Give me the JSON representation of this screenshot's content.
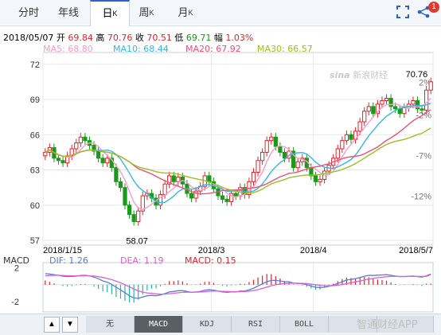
{
  "tabs": [
    {
      "label": "分时",
      "sup": ""
    },
    {
      "label": "年线",
      "sup": ""
    },
    {
      "label": "日",
      "sup": "K"
    },
    {
      "label": "周",
      "sup": "K"
    },
    {
      "label": "月",
      "sup": "K"
    }
  ],
  "badge": "1",
  "quote": {
    "date": "2018/05/07",
    "open_label": "开",
    "open": "69.84",
    "high_label": "高",
    "high": "70.76",
    "close_label": "收",
    "close": "70.51",
    "low_label": "低",
    "low": "69.71",
    "change_label": "幅",
    "change": "1.03%"
  },
  "ma": [
    {
      "label": "MA5: 68.80",
      "color": "#ff9bc8"
    },
    {
      "label": "MA10: 68.44",
      "color": "#35b6e6"
    },
    {
      "label": "MA20: 67.92",
      "color": "#f0507a"
    },
    {
      "label": "MA30: 66.57",
      "color": "#9fbf1f"
    }
  ],
  "macd_labels": {
    "title": "MACD",
    "dif": "DIF: 1.26",
    "dea": "DEA: 1.19",
    "macd": "MACD: 0.15"
  },
  "watermark": {
    "top": "新浪财经",
    "bottom": "智通财经APP"
  },
  "bottom_bar": {
    "prev": "▲",
    "next": "▼",
    "indicators": [
      "无",
      "MACD",
      "KDJ",
      "RSI",
      "BOLL",
      "",
      ""
    ]
  },
  "chart_data": {
    "type": "candlestick",
    "ylim": [
      56.6,
      73.0
    ],
    "y_ticks": [
      "72",
      "69",
      "66",
      "63",
      "60",
      "57"
    ],
    "y_pct_ticks": [
      "2%",
      "-2%",
      "-7%",
      "-12%"
    ],
    "x_tick_labels": [
      "2018/1/15",
      "2018/3",
      "2018/4",
      "2018/5/7"
    ],
    "x_tick_index": [
      0,
      38,
      61,
      87
    ],
    "annotations": {
      "max": "70.76",
      "min": "58.07"
    },
    "macd_ticks": [
      "2",
      "-2"
    ],
    "macd_ylim": [
      -3.2,
      2.6
    ],
    "close": [
      64.5,
      64.9,
      64.0,
      63.8,
      63.6,
      64.2,
      64.8,
      65.3,
      65.8,
      65.5,
      65.1,
      64.6,
      64.0,
      63.6,
      64.0,
      63.2,
      62.0,
      61.5,
      60.0,
      59.2,
      58.6,
      59.5,
      60.8,
      61.0,
      60.6,
      60.0,
      60.9,
      61.8,
      62.5,
      62.0,
      62.4,
      61.8,
      61.0,
      60.6,
      61.2,
      61.6,
      62.5,
      62.0,
      61.4,
      60.8,
      60.5,
      60.3,
      61.0,
      60.8,
      61.5,
      60.9,
      62.0,
      62.8,
      63.8,
      64.5,
      65.5,
      65.8,
      65.0,
      64.5,
      64.0,
      64.6,
      63.2,
      63.7,
      64.0,
      63.2,
      62.5,
      62.0,
      62.2,
      62.9,
      63.4,
      64.0,
      64.8,
      65.5,
      66.0,
      65.6,
      66.3,
      67.1,
      68.0,
      68.4,
      67.8,
      68.6,
      68.9,
      69.1,
      68.4,
      68.2,
      67.8,
      68.3,
      68.6,
      68.9,
      68.2,
      68.1,
      69.8,
      70.51
    ],
    "macd": {
      "dif": [
        1.3,
        1.25,
        1.18,
        1.1,
        1.0,
        0.95,
        0.96,
        1.0,
        1.08,
        1.1,
        1.05,
        0.9,
        0.7,
        0.45,
        0.3,
        0.05,
        -0.3,
        -0.6,
        -0.95,
        -1.3,
        -1.55,
        -1.6,
        -1.45,
        -1.3,
        -1.25,
        -1.3,
        -1.2,
        -1.05,
        -0.85,
        -0.8,
        -0.7,
        -0.7,
        -0.8,
        -0.9,
        -0.85,
        -0.8,
        -0.65,
        -0.6,
        -0.65,
        -0.75,
        -0.85,
        -0.9,
        -0.85,
        -0.85,
        -0.75,
        -0.75,
        -0.6,
        -0.4,
        -0.15,
        0.1,
        0.35,
        0.5,
        0.5,
        0.45,
        0.35,
        0.35,
        0.2,
        0.15,
        0.12,
        0.0,
        -0.15,
        -0.3,
        -0.35,
        -0.3,
        -0.2,
        -0.05,
        0.15,
        0.35,
        0.55,
        0.62,
        0.7,
        0.85,
        1.0,
        1.1,
        1.08,
        1.12,
        1.15,
        1.18,
        1.1,
        1.02,
        0.95,
        0.95,
        0.98,
        1.02,
        0.95,
        0.9,
        1.05,
        1.26
      ],
      "dea": [
        1.05,
        1.08,
        1.1,
        1.1,
        1.08,
        1.06,
        1.04,
        1.03,
        1.04,
        1.05,
        1.05,
        1.02,
        0.95,
        0.85,
        0.74,
        0.6,
        0.42,
        0.22,
        0.0,
        -0.25,
        -0.5,
        -0.72,
        -0.87,
        -0.96,
        -1.02,
        -1.08,
        -1.1,
        -1.1,
        -1.06,
        -1.01,
        -0.95,
        -0.9,
        -0.88,
        -0.88,
        -0.87,
        -0.86,
        -0.82,
        -0.78,
        -0.76,
        -0.76,
        -0.78,
        -0.8,
        -0.81,
        -0.82,
        -0.81,
        -0.8,
        -0.76,
        -0.69,
        -0.58,
        -0.44,
        -0.28,
        -0.12,
        0.0,
        0.08,
        0.13,
        0.17,
        0.18,
        0.17,
        0.16,
        0.13,
        0.07,
        0.0,
        -0.07,
        -0.12,
        -0.13,
        -0.11,
        -0.06,
        0.02,
        0.13,
        0.23,
        0.33,
        0.44,
        0.55,
        0.66,
        0.74,
        0.82,
        0.88,
        0.94,
        0.97,
        0.98,
        0.97,
        0.97,
        0.97,
        0.98,
        0.98,
        0.97,
        0.99,
        1.19
      ]
    }
  }
}
